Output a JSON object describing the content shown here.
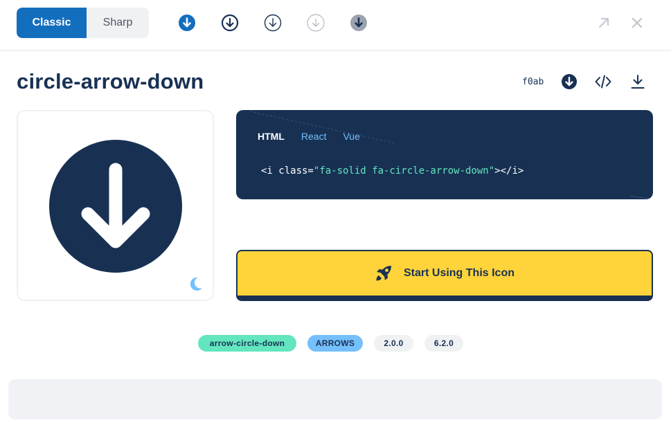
{
  "style_toggle": {
    "classic": "Classic",
    "sharp": "Sharp"
  },
  "variants": [
    {
      "name": "solid-blue",
      "color": "#146ebe"
    },
    {
      "name": "regular",
      "color": "#183153"
    },
    {
      "name": "light",
      "color": "#183153"
    },
    {
      "name": "thin",
      "color": "#9ca3af"
    },
    {
      "name": "duotone",
      "color": "#9ca3af"
    }
  ],
  "topbar_icons": [
    "expand-arrow-icon",
    "close-icon"
  ],
  "icon": {
    "title": "circle-arrow-down",
    "unicode": "f0ab"
  },
  "actions": [
    "copy-glyph-icon",
    "code-icon",
    "download-icon"
  ],
  "code": {
    "tabs": [
      "HTML",
      "React",
      "Vue"
    ],
    "active_tab": "HTML",
    "open": "<i class=",
    "value": "\"fa-solid fa-circle-arrow-down\"",
    "close": "></i>"
  },
  "cta": {
    "label": "Start Using This Icon"
  },
  "tags": {
    "alias": "arrow-circle-down",
    "category": "ARROWS",
    "version_added": "2.0.0",
    "version_updated": "6.2.0"
  },
  "colors": {
    "navy": "#183153",
    "blue": "#146ebe",
    "yellow": "#ffd43b",
    "teal": "#63e6be",
    "sky": "#74c0fc"
  }
}
